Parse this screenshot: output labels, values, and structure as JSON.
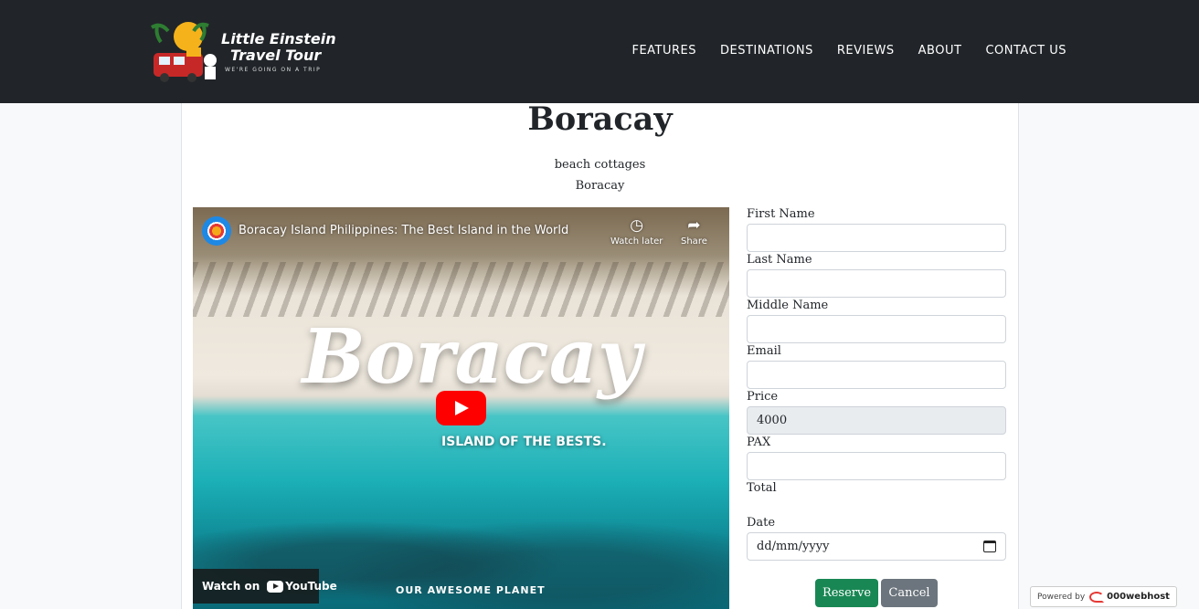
{
  "brand": {
    "title_line1": "Little Einstein",
    "title_line2": "Travel Tour",
    "tagline": "WE'RE GOING ON A TRIP"
  },
  "nav": {
    "items": [
      "FEATURES",
      "DESTINATIONS",
      "REVIEWS",
      "ABOUT",
      "CONTACT US"
    ]
  },
  "destination": {
    "title": "Boracay",
    "subtitle": "beach cottages",
    "location": "Boracay"
  },
  "video": {
    "title": "Boracay Island Philippines: The Best Island in the World",
    "watch_later": "Watch later",
    "share": "Share",
    "overlay_title": "Boracay",
    "overlay_subtitle": "ISLAND OF THE BESTS.",
    "watch_on": "Watch on",
    "youtube": "YouTube",
    "channel_brand": "OUR AWESOME PLANET"
  },
  "form": {
    "first_name_label": "First Name",
    "first_name_value": "",
    "last_name_label": "Last Name",
    "last_name_value": "",
    "middle_name_label": "Middle Name",
    "middle_name_value": "",
    "email_label": "Email",
    "email_value": "",
    "price_label": "Price",
    "price_value": "4000",
    "pax_label": "PAX",
    "pax_value": "",
    "total_label": "Total",
    "date_label": "Date",
    "date_placeholder": "dd/mm/yyyy",
    "reserve_label": "Reserve",
    "cancel_label": "Cancel"
  },
  "footer_badge": {
    "powered_by": "Powered by",
    "host": "000webhost"
  },
  "colors": {
    "navbar": "#212529",
    "reserve": "#198754",
    "cancel": "#6c757d",
    "youtube_red": "#ff0000"
  }
}
